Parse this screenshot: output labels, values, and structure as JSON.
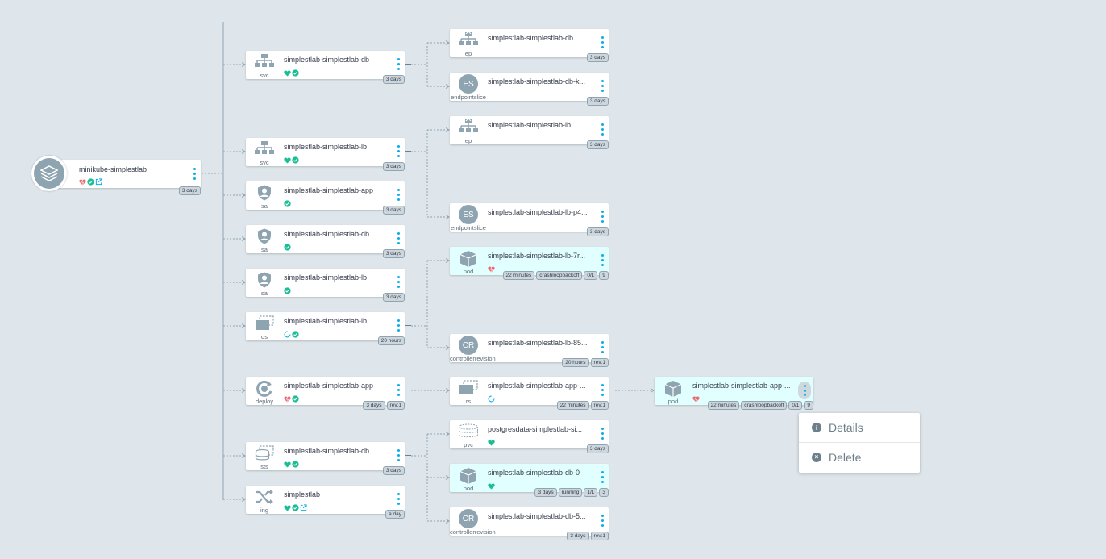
{
  "app": {
    "title": "minikube-simplestlab",
    "age": "3 days",
    "status": [
      "health-degraded",
      "sync-synced",
      "external-link"
    ]
  },
  "nodes": [
    {
      "id": "svc-db",
      "kind": "svc",
      "icon": "service-icon",
      "title": "simplestlab-simplestlab-db",
      "status": [
        "health-healthy",
        "sync-synced"
      ],
      "tags": [
        "3 days"
      ]
    },
    {
      "id": "svc-lb",
      "kind": "svc",
      "icon": "service-icon",
      "title": "simplestlab-simplestlab-lb",
      "status": [
        "health-healthy",
        "sync-synced"
      ],
      "tags": [
        "3 days"
      ]
    },
    {
      "id": "sa-app",
      "kind": "sa",
      "icon": "serviceaccount-icon",
      "title": "simplestlab-simplestlab-app",
      "status": [
        "sync-synced"
      ],
      "tags": [
        "3 days"
      ]
    },
    {
      "id": "sa-db",
      "kind": "sa",
      "icon": "serviceaccount-icon",
      "title": "simplestlab-simplestlab-db",
      "status": [
        "sync-synced"
      ],
      "tags": [
        "3 days"
      ]
    },
    {
      "id": "sa-lb",
      "kind": "sa",
      "icon": "serviceaccount-icon",
      "title": "simplestlab-simplestlab-lb",
      "status": [
        "sync-synced"
      ],
      "tags": [
        "3 days"
      ]
    },
    {
      "id": "ds-lb",
      "kind": "ds",
      "icon": "daemonset-icon",
      "title": "simplestlab-simplestlab-lb",
      "status": [
        "health-progressing",
        "sync-synced"
      ],
      "tags": [
        "20 hours"
      ]
    },
    {
      "id": "deploy-app",
      "kind": "deploy",
      "icon": "deployment-icon",
      "title": "simplestlab-simplestlab-app",
      "status": [
        "health-degraded",
        "sync-synced"
      ],
      "tags": [
        "3 days",
        "rev:1"
      ]
    },
    {
      "id": "sts-db",
      "kind": "sts",
      "icon": "statefulset-icon",
      "title": "simplestlab-simplestlab-db",
      "status": [
        "health-healthy",
        "sync-synced"
      ],
      "tags": [
        "3 days"
      ]
    },
    {
      "id": "ing",
      "kind": "ing",
      "icon": "ingress-icon",
      "title": "simplestlab",
      "status": [
        "health-healthy",
        "sync-synced",
        "external-link"
      ],
      "tags": [
        "a day"
      ]
    },
    {
      "id": "ep-db",
      "kind": "ep",
      "icon": "endpoint-icon",
      "title": "simplestlab-simplestlab-db",
      "status": [],
      "tags": [
        "3 days"
      ]
    },
    {
      "id": "es-db",
      "kind": "endpointslice",
      "icon": "endpointslice-icon",
      "letters": "ES",
      "title": "simplestlab-simplestlab-db-k...",
      "status": [],
      "tags": [
        "3 days"
      ]
    },
    {
      "id": "ep-lb",
      "kind": "ep",
      "icon": "endpoint-icon",
      "title": "simplestlab-simplestlab-lb",
      "status": [],
      "tags": [
        "3 days"
      ]
    },
    {
      "id": "es-lb",
      "kind": "endpointslice",
      "icon": "endpointslice-icon",
      "letters": "ES",
      "title": "simplestlab-simplestlab-lb-p4...",
      "status": [],
      "tags": [
        "3 days"
      ]
    },
    {
      "id": "pod-lb",
      "kind": "pod",
      "icon": "pod-icon",
      "title": "simplestlab-simplestlab-lb-7r...",
      "status": [
        "health-degraded"
      ],
      "tags": [
        "22 minutes",
        "crashloopbackoff",
        "0/1",
        "9"
      ]
    },
    {
      "id": "cr-lb",
      "kind": "controllerrevision",
      "icon": "controllerrevision-icon",
      "letters": "CR",
      "title": "simplestlab-simplestlab-lb-85...",
      "status": [],
      "tags": [
        "20 hours",
        "rev:1"
      ]
    },
    {
      "id": "rs-app",
      "kind": "rs",
      "icon": "replicaset-icon",
      "title": "simplestlab-simplestlab-app-...",
      "status": [
        "health-progressing"
      ],
      "tags": [
        "22 minutes",
        "rev:1"
      ]
    },
    {
      "id": "pvc-db",
      "kind": "pvc",
      "icon": "pvc-icon",
      "title": "postgresdata-simplestlab-si...",
      "status": [
        "health-healthy"
      ],
      "tags": [
        "3 days"
      ]
    },
    {
      "id": "pod-db",
      "kind": "pod",
      "icon": "pod-icon",
      "title": "simplestlab-simplestlab-db-0",
      "status": [
        "health-healthy"
      ],
      "tags": [
        "3 days",
        "running",
        "1/1",
        "3"
      ]
    },
    {
      "id": "cr-db",
      "kind": "controllerrevision",
      "icon": "controllerrevision-icon",
      "letters": "CR",
      "title": "simplestlab-simplestlab-db-5...",
      "status": [],
      "tags": [
        "3 days",
        "rev:1"
      ]
    },
    {
      "id": "pod-app",
      "kind": "pod",
      "icon": "pod-icon",
      "title": "simplestlab-simplestlab-app-...",
      "status": [
        "health-degraded"
      ],
      "tags": [
        "22 minutes",
        "crashloopbackoff",
        "0/1",
        "9"
      ]
    }
  ],
  "context_menu": {
    "items": [
      {
        "label": "Details",
        "icon": "info-icon"
      },
      {
        "label": "Delete",
        "icon": "delete-icon"
      }
    ]
  },
  "colors": {
    "background": "#dee6eb",
    "healthy": "#18be94",
    "degraded": "#e96d76",
    "progressing": "#0dadea",
    "menu_dots": "#0dadea",
    "icon_gray": "#8fa4b1",
    "pod_bg": "#e0fffe"
  }
}
